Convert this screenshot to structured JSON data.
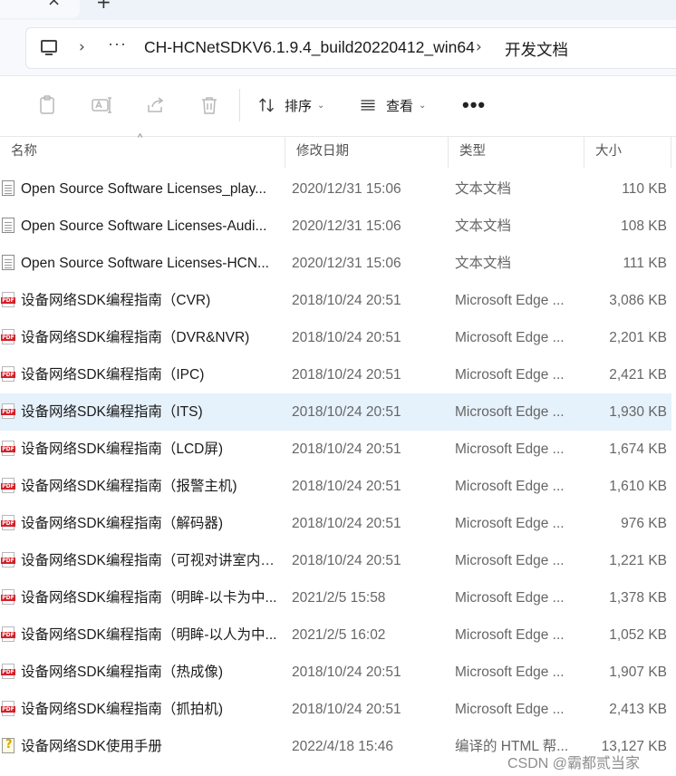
{
  "tab": {
    "close_glyph": "×",
    "new_glyph": "+"
  },
  "address": {
    "more": "···",
    "sep": "›",
    "crumbs": [
      "CH-HCNetSDKV6.1.9.4_build20220412_win64",
      "开发文档"
    ]
  },
  "toolbar": {
    "sort_label": "排序",
    "view_label": "查看",
    "more_label": "•••",
    "caret": "⌄",
    "icons": [
      "paste-icon",
      "rename-icon",
      "share-icon",
      "delete-icon",
      "sort-icon",
      "view-icon"
    ]
  },
  "header": {
    "name": "名称",
    "date": "修改日期",
    "type": "类型",
    "size": "大小",
    "sort_indicator": "^"
  },
  "files": [
    {
      "name": "Open Source Software Licenses_play...",
      "date": "2020/12/31 15:06",
      "type": "文本文档",
      "size": "110 KB",
      "icon": "txt"
    },
    {
      "name": "Open Source Software Licenses-Audi...",
      "date": "2020/12/31 15:06",
      "type": "文本文档",
      "size": "108 KB",
      "icon": "txt"
    },
    {
      "name": "Open Source Software Licenses-HCN...",
      "date": "2020/12/31 15:06",
      "type": "文本文档",
      "size": "111 KB",
      "icon": "txt"
    },
    {
      "name": "设备网络SDK编程指南（CVR)",
      "date": "2018/10/24 20:51",
      "type": "Microsoft Edge ...",
      "size": "3,086 KB",
      "icon": "pdf"
    },
    {
      "name": "设备网络SDK编程指南（DVR&NVR)",
      "date": "2018/10/24 20:51",
      "type": "Microsoft Edge ...",
      "size": "2,201 KB",
      "icon": "pdf"
    },
    {
      "name": "设备网络SDK编程指南（IPC)",
      "date": "2018/10/24 20:51",
      "type": "Microsoft Edge ...",
      "size": "2,421 KB",
      "icon": "pdf"
    },
    {
      "name": "设备网络SDK编程指南（ITS)",
      "date": "2018/10/24 20:51",
      "type": "Microsoft Edge ...",
      "size": "1,930 KB",
      "icon": "pdf",
      "selected": true
    },
    {
      "name": "设备网络SDK编程指南（LCD屏)",
      "date": "2018/10/24 20:51",
      "type": "Microsoft Edge ...",
      "size": "1,674 KB",
      "icon": "pdf"
    },
    {
      "name": "设备网络SDK编程指南（报警主机)",
      "date": "2018/10/24 20:51",
      "type": "Microsoft Edge ...",
      "size": "1,610 KB",
      "icon": "pdf"
    },
    {
      "name": "设备网络SDK编程指南（解码器)",
      "date": "2018/10/24 20:51",
      "type": "Microsoft Edge ...",
      "size": "976 KB",
      "icon": "pdf"
    },
    {
      "name": "设备网络SDK编程指南（可视对讲室内机...",
      "date": "2018/10/24 20:51",
      "type": "Microsoft Edge ...",
      "size": "1,221 KB",
      "icon": "pdf"
    },
    {
      "name": "设备网络SDK编程指南（明眸-以卡为中...",
      "date": "2021/2/5 15:58",
      "type": "Microsoft Edge ...",
      "size": "1,378 KB",
      "icon": "pdf"
    },
    {
      "name": "设备网络SDK编程指南（明眸-以人为中...",
      "date": "2021/2/5 16:02",
      "type": "Microsoft Edge ...",
      "size": "1,052 KB",
      "icon": "pdf"
    },
    {
      "name": "设备网络SDK编程指南（热成像)",
      "date": "2018/10/24 20:51",
      "type": "Microsoft Edge ...",
      "size": "1,907 KB",
      "icon": "pdf"
    },
    {
      "name": "设备网络SDK编程指南（抓拍机)",
      "date": "2018/10/24 20:51",
      "type": "Microsoft Edge ...",
      "size": "2,413 KB",
      "icon": "pdf"
    },
    {
      "name": "设备网络SDK使用手册",
      "date": "2022/4/18 15:46",
      "type": "编译的 HTML 帮...",
      "size": "13,127 KB",
      "icon": "chm"
    }
  ],
  "watermark": "CSDN @霸都贰当家",
  "colors": {
    "selected_row": "#e5f1fb",
    "pdf_red": "#d4202a"
  }
}
